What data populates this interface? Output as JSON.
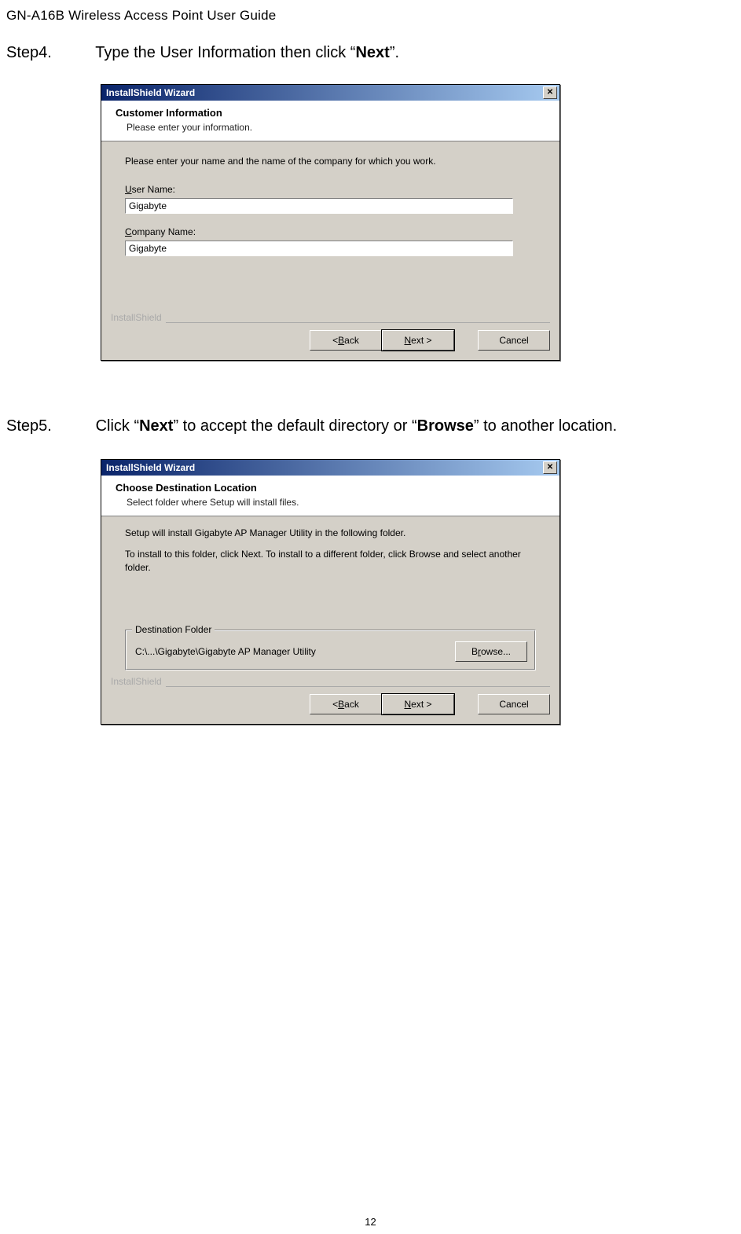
{
  "doc": {
    "header": "GN-A16B Wireless Access Point  User Guide",
    "page_number": "12"
  },
  "step4": {
    "label": "Step4.",
    "text_before": "Type the User Information then click “",
    "bold": "Next",
    "text_after": "”."
  },
  "step5": {
    "label": "Step5.",
    "t1": "Click “",
    "b1": "Next",
    "t2": "” to accept the default directory or “",
    "b2": "Browse",
    "t3": "” to another location."
  },
  "dialog1": {
    "title": "InstallShield Wizard",
    "close": "✕",
    "head_title": "Customer Information",
    "head_sub": "Please enter your information.",
    "instruction": "Please enter your name and the name of the company for which you work.",
    "user_label": "User Name:",
    "user_value": "Gigabyte",
    "company_label": "Company Name:",
    "company_value": "Gigabyte",
    "brandline": "InstallShield",
    "btn_back": "< Back",
    "btn_next": "Next >",
    "btn_cancel": "Cancel"
  },
  "dialog2": {
    "title": "InstallShield Wizard",
    "close": "✕",
    "head_title": "Choose Destination Location",
    "head_sub": "Select folder where Setup will install files.",
    "line1": "Setup will install Gigabyte AP Manager Utility in the following folder.",
    "line2": "To install to this folder, click Next. To install to a different folder, click Browse and select another folder.",
    "group_title": "Destination Folder",
    "dest_path": "C:\\...\\Gigabyte\\Gigabyte AP Manager Utility",
    "btn_browse": "Browse...",
    "brandline": "InstallShield",
    "btn_back": "< Back",
    "btn_next": "Next >",
    "btn_cancel": "Cancel"
  }
}
